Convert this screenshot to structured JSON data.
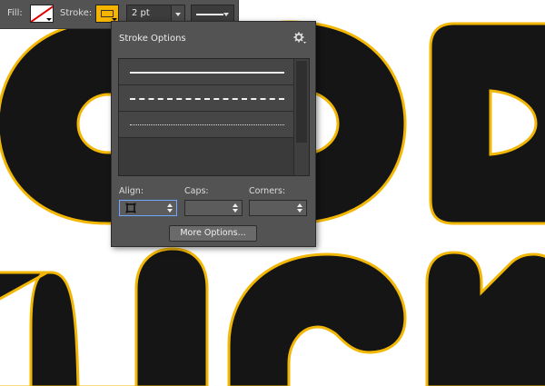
{
  "options_bar": {
    "fill_label": "Fill:",
    "stroke_label": "Stroke:",
    "stroke_weight": "2 pt",
    "fill_swatch": "none-swatch-red-slash",
    "stroke_color": "#f5b400"
  },
  "stroke_panel": {
    "title": "Stroke Options",
    "gear_icon": "gear-icon",
    "stroke_types": [
      "solid",
      "dashed",
      "dotted"
    ],
    "align_label": "Align:",
    "caps_label": "Caps:",
    "corners_label": "Corners:",
    "more_options_label": "More Options..."
  },
  "artwork": {
    "shape_fill": "#151515",
    "shape_stroke": "#f2b705"
  }
}
